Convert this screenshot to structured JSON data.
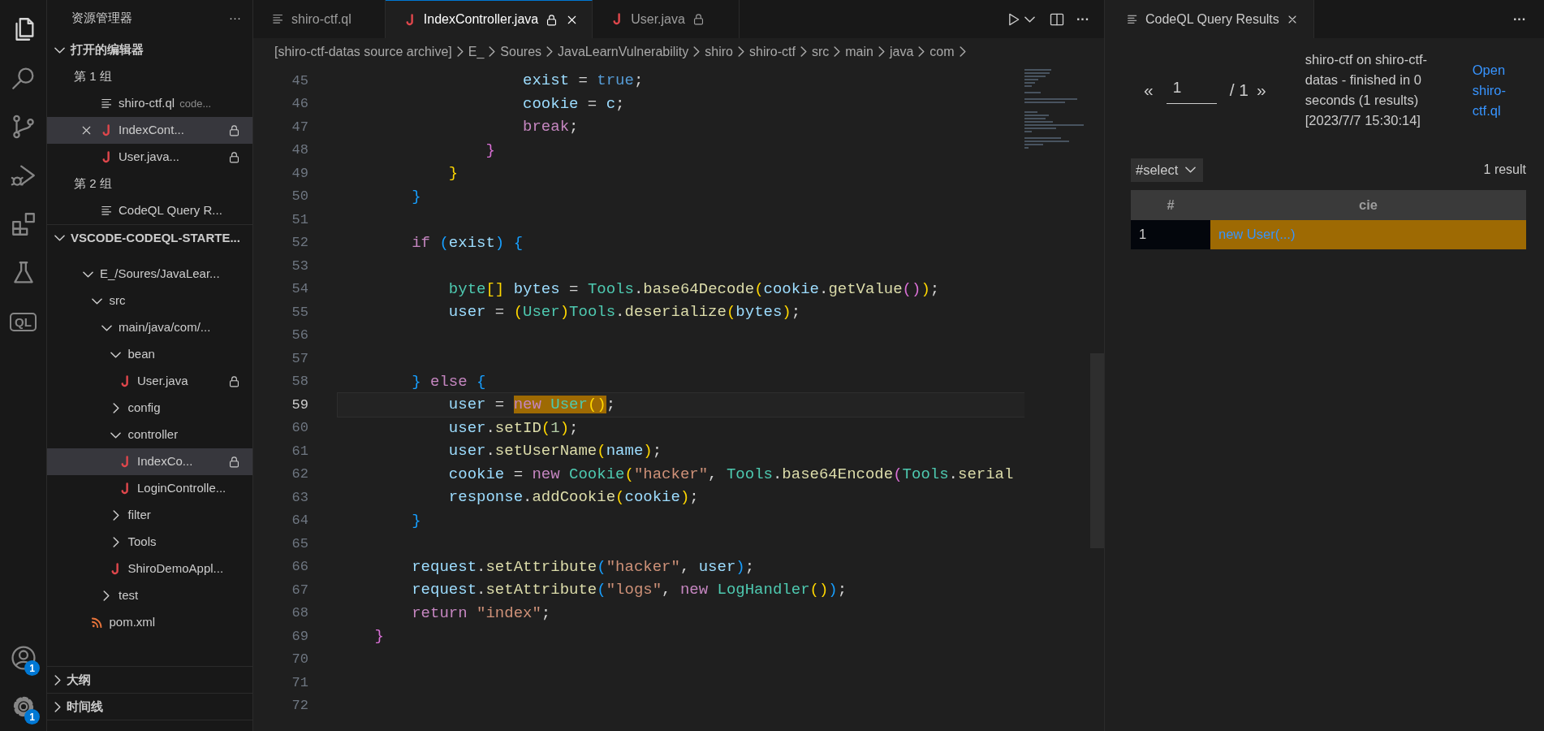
{
  "activity_bar": {
    "top_items": [
      {
        "kind": "explorer",
        "selected": true
      },
      {
        "kind": "search",
        "selected": false
      },
      {
        "kind": "source-control",
        "selected": false
      },
      {
        "kind": "run-debug",
        "selected": false
      },
      {
        "kind": "extensions",
        "selected": false
      },
      {
        "kind": "testing",
        "selected": false
      },
      {
        "kind": "codeql",
        "label": "QL",
        "selected": false
      }
    ],
    "bottom_items": [
      {
        "kind": "account",
        "badge": "1",
        "selected": false
      },
      {
        "kind": "settings",
        "badge": "1",
        "selected": false
      }
    ]
  },
  "sidebar": {
    "title": "资源管理器",
    "more": "···",
    "open_editors": {
      "title": "打开的编辑器",
      "expanded": true,
      "groups": [
        {
          "label": "第 1 组",
          "items": [
            {
              "label": "shiro-ctf.ql",
              "description": "code...",
              "kind": "ql",
              "locked": false,
              "selected": false
            },
            {
              "label": "IndexCont...",
              "kind": "java",
              "locked": true,
              "selected": true
            },
            {
              "label": "User.java...",
              "kind": "java",
              "locked": true,
              "selected": false
            }
          ]
        },
        {
          "label": "第 2 组",
          "items": [
            {
              "label": "CodeQL Query R...",
              "kind": "ql",
              "locked": false,
              "selected": false
            }
          ]
        }
      ]
    },
    "workspace": {
      "title": "VSCODE-CODEQL-STARTE...",
      "expanded": true,
      "items": [
        {
          "label": "E_/Soures/JavaLear...",
          "kind": "folder",
          "expanded": true,
          "children": [
            {
              "label": "src",
              "kind": "folder",
              "expanded": true,
              "children": [
                {
                  "label": "main/java/com/...",
                  "kind": "folder",
                  "expanded": true,
                  "children": [
                    {
                      "label": "bean",
                      "kind": "folder",
                      "expanded": true,
                      "children": [
                        {
                          "label": "User.java",
                          "kind": "java",
                          "locked": true,
                          "selected": false
                        }
                      ]
                    },
                    {
                      "label": "config",
                      "kind": "folder",
                      "expanded": false
                    },
                    {
                      "label": "controller",
                      "kind": "folder",
                      "expanded": true,
                      "children": [
                        {
                          "label": "IndexCo...",
                          "kind": "java",
                          "locked": true,
                          "selected": true
                        },
                        {
                          "label": "LoginControlle...",
                          "kind": "java",
                          "locked": false,
                          "selected": false
                        }
                      ]
                    },
                    {
                      "label": "filter",
                      "kind": "folder",
                      "expanded": false
                    },
                    {
                      "label": "Tools",
                      "kind": "folder",
                      "expanded": false
                    },
                    {
                      "label": "ShiroDemoAppl...",
                      "kind": "java",
                      "locked": false,
                      "selected": false
                    }
                  ]
                },
                {
                  "label": "test",
                  "kind": "folder",
                  "expanded": false
                }
              ]
            },
            {
              "label": "pom.xml",
              "kind": "xml",
              "locked": false,
              "selected": false
            }
          ]
        }
      ]
    },
    "collapsed_sections": [
      {
        "title": "大纲",
        "expanded": false
      },
      {
        "title": "时间线",
        "expanded": false
      }
    ]
  },
  "editor": {
    "tabs": [
      {
        "label": "shiro-ctf.ql",
        "kind": "ql",
        "locked": false,
        "selected": false
      },
      {
        "label": "IndexController.java",
        "kind": "java",
        "locked": true,
        "selected": true
      },
      {
        "label": "User.java",
        "kind": "java",
        "locked": true,
        "selected": false
      }
    ],
    "breadcrumb": [
      "[shiro-ctf-datas source archive]",
      "E_",
      "Soures",
      "JavaLearnVulnerability",
      "shiro",
      "shiro-ctf",
      "src",
      "main",
      "java",
      "com"
    ],
    "lines": [
      {
        "number": "45",
        "current": false,
        "tokens": [
          {
            "kind": "var",
            "text": "                    exist"
          },
          {
            "kind": "plain",
            "text": " = "
          },
          {
            "kind": "const",
            "text": "true"
          },
          {
            "kind": "plain",
            "text": ";"
          }
        ]
      },
      {
        "number": "46",
        "current": false,
        "tokens": [
          {
            "kind": "var",
            "text": "                    cookie"
          },
          {
            "kind": "plain",
            "text": " = "
          },
          {
            "kind": "var",
            "text": "c"
          },
          {
            "kind": "plain",
            "text": ";"
          }
        ]
      },
      {
        "number": "47",
        "current": false,
        "tokens": [
          {
            "kind": "control",
            "text": "                    break"
          },
          {
            "kind": "plain",
            "text": ";"
          }
        ]
      },
      {
        "number": "48",
        "current": false,
        "tokens": [
          {
            "kind": "b2",
            "text": "                }"
          }
        ]
      },
      {
        "number": "49",
        "current": false,
        "tokens": [
          {
            "kind": "b1",
            "text": "            }"
          }
        ]
      },
      {
        "number": "50",
        "current": false,
        "tokens": [
          {
            "kind": "b3",
            "text": "        }"
          }
        ]
      },
      {
        "number": "51",
        "current": false
      },
      {
        "number": "52",
        "current": false,
        "tokens": [
          {
            "kind": "control",
            "text": "        if "
          },
          {
            "kind": "b3",
            "text": "("
          },
          {
            "kind": "var",
            "text": "exist"
          },
          {
            "kind": "b3",
            "text": ") {"
          }
        ]
      },
      {
        "number": "53",
        "current": false
      },
      {
        "number": "54",
        "current": false,
        "tokens": [
          {
            "kind": "type",
            "text": "            byte"
          },
          {
            "kind": "b1",
            "text": "[]"
          },
          {
            "kind": "var",
            "text": " bytes"
          },
          {
            "kind": "plain",
            "text": " = "
          },
          {
            "kind": "type",
            "text": "Tools"
          },
          {
            "kind": "plain",
            "text": "."
          },
          {
            "kind": "fn",
            "text": "base64Decode"
          },
          {
            "kind": "b1",
            "text": "("
          },
          {
            "kind": "var",
            "text": "cookie"
          },
          {
            "kind": "plain",
            "text": "."
          },
          {
            "kind": "fn",
            "text": "getValue"
          },
          {
            "kind": "b2",
            "text": "()"
          },
          {
            "kind": "b1",
            "text": ")"
          },
          {
            "kind": "plain",
            "text": ";"
          }
        ]
      },
      {
        "number": "55",
        "current": false,
        "tokens": [
          {
            "kind": "var",
            "text": "            user"
          },
          {
            "kind": "plain",
            "text": " = "
          },
          {
            "kind": "b1",
            "text": "("
          },
          {
            "kind": "type",
            "text": "User"
          },
          {
            "kind": "b1",
            "text": ")"
          },
          {
            "kind": "type",
            "text": "Tools"
          },
          {
            "kind": "plain",
            "text": "."
          },
          {
            "kind": "fn",
            "text": "deserialize"
          },
          {
            "kind": "b1",
            "text": "("
          },
          {
            "kind": "var",
            "text": "bytes"
          },
          {
            "kind": "b1",
            "text": ")"
          },
          {
            "kind": "plain",
            "text": ";"
          }
        ]
      },
      {
        "number": "56",
        "current": false
      },
      {
        "number": "57",
        "current": false
      },
      {
        "number": "58",
        "current": false,
        "tokens": [
          {
            "kind": "b3",
            "text": "        }"
          },
          {
            "kind": "control",
            "text": " else "
          },
          {
            "kind": "b3",
            "text": "{"
          }
        ]
      },
      {
        "number": "59",
        "current": true,
        "tokens": [
          {
            "kind": "var",
            "text": "            user"
          },
          {
            "kind": "plain",
            "text": " = "
          },
          {
            "kind": "control",
            "text": "new ",
            "match": true
          },
          {
            "kind": "type",
            "text": "User",
            "match": true
          },
          {
            "kind": "b1",
            "text": "()",
            "match": true
          },
          {
            "kind": "plain",
            "text": ";"
          }
        ]
      },
      {
        "number": "60",
        "current": false,
        "tokens": [
          {
            "kind": "var",
            "text": "            user"
          },
          {
            "kind": "plain",
            "text": "."
          },
          {
            "kind": "fn",
            "text": "setID"
          },
          {
            "kind": "b1",
            "text": "("
          },
          {
            "kind": "num",
            "text": "1"
          },
          {
            "kind": "b1",
            "text": ")"
          },
          {
            "kind": "plain",
            "text": ";"
          }
        ]
      },
      {
        "number": "61",
        "current": false,
        "tokens": [
          {
            "kind": "var",
            "text": "            user"
          },
          {
            "kind": "plain",
            "text": "."
          },
          {
            "kind": "fn",
            "text": "setUserName"
          },
          {
            "kind": "b1",
            "text": "("
          },
          {
            "kind": "var",
            "text": "name"
          },
          {
            "kind": "b1",
            "text": ")"
          },
          {
            "kind": "plain",
            "text": ";"
          }
        ]
      },
      {
        "number": "62",
        "current": false,
        "tokens": [
          {
            "kind": "var",
            "text": "            cookie"
          },
          {
            "kind": "plain",
            "text": " = "
          },
          {
            "kind": "control",
            "text": "new "
          },
          {
            "kind": "type",
            "text": "Cookie"
          },
          {
            "kind": "b1",
            "text": "("
          },
          {
            "kind": "str",
            "text": "\"hacker\""
          },
          {
            "kind": "plain",
            "text": ", "
          },
          {
            "kind": "type",
            "text": "Tools"
          },
          {
            "kind": "plain",
            "text": "."
          },
          {
            "kind": "fn",
            "text": "base64Encode"
          },
          {
            "kind": "b2",
            "text": "("
          },
          {
            "kind": "type",
            "text": "Tools"
          },
          {
            "kind": "plain",
            "text": "."
          },
          {
            "kind": "fn",
            "text": "serial"
          }
        ]
      },
      {
        "number": "63",
        "current": false,
        "tokens": [
          {
            "kind": "var",
            "text": "            response"
          },
          {
            "kind": "plain",
            "text": "."
          },
          {
            "kind": "fn",
            "text": "addCookie"
          },
          {
            "kind": "b1",
            "text": "("
          },
          {
            "kind": "var",
            "text": "cookie"
          },
          {
            "kind": "b1",
            "text": ")"
          },
          {
            "kind": "plain",
            "text": ";"
          }
        ]
      },
      {
        "number": "64",
        "current": false,
        "tokens": [
          {
            "kind": "b3",
            "text": "        }"
          }
        ]
      },
      {
        "number": "65",
        "current": false
      },
      {
        "number": "66",
        "current": false,
        "tokens": [
          {
            "kind": "var",
            "text": "        request"
          },
          {
            "kind": "plain",
            "text": "."
          },
          {
            "kind": "fn",
            "text": "setAttribute"
          },
          {
            "kind": "b3",
            "text": "("
          },
          {
            "kind": "str",
            "text": "\"hacker\""
          },
          {
            "kind": "plain",
            "text": ", "
          },
          {
            "kind": "var",
            "text": "user"
          },
          {
            "kind": "b3",
            "text": ")"
          },
          {
            "kind": "plain",
            "text": ";"
          }
        ]
      },
      {
        "number": "67",
        "current": false,
        "tokens": [
          {
            "kind": "var",
            "text": "        request"
          },
          {
            "kind": "plain",
            "text": "."
          },
          {
            "kind": "fn",
            "text": "setAttribute"
          },
          {
            "kind": "b3",
            "text": "("
          },
          {
            "kind": "str",
            "text": "\"logs\""
          },
          {
            "kind": "plain",
            "text": ", "
          },
          {
            "kind": "control",
            "text": "new "
          },
          {
            "kind": "type",
            "text": "LogHandler"
          },
          {
            "kind": "b1",
            "text": "()"
          },
          {
            "kind": "b3",
            "text": ")"
          },
          {
            "kind": "plain",
            "text": ";"
          }
        ]
      },
      {
        "number": "68",
        "current": false,
        "tokens": [
          {
            "kind": "control",
            "text": "        return "
          },
          {
            "kind": "str",
            "text": "\"index\""
          },
          {
            "kind": "plain",
            "text": ";"
          }
        ]
      },
      {
        "number": "69",
        "current": false,
        "tokens": [
          {
            "kind": "b2",
            "text": "    }"
          }
        ]
      },
      {
        "number": "70",
        "current": false
      },
      {
        "number": "71",
        "current": false
      },
      {
        "number": "72",
        "current": false
      }
    ]
  },
  "results_panel": {
    "tab": {
      "label": "CodeQL Query Results",
      "selected": true
    },
    "more": "···",
    "pager": {
      "prev": "«",
      "page": "1",
      "total": "/ 1",
      "next": "»"
    },
    "summary": "shiro-ctf on shiro-ctf-datas - finished in 0 seconds (1 results) [2023/7/7 15:30:14]",
    "open_link": "Open shiro-ctf.ql",
    "result_set": "#select",
    "count": "1 result",
    "table": {
      "columns": [
        "#",
        "cie"
      ],
      "rows": [
        {
          "cells": [
            "1",
            "new User(...)"
          ],
          "selected": true
        }
      ]
    }
  }
}
